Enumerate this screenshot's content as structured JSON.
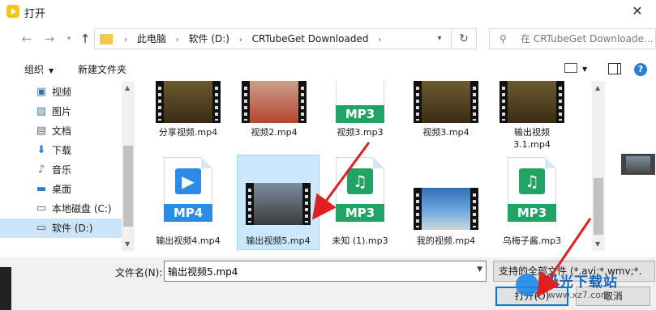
{
  "window": {
    "title": "打开",
    "close": "✕"
  },
  "nav": {
    "crumbs": [
      "此电脑",
      "软件 (D:)",
      "CRTubeGet Downloaded"
    ],
    "search_placeholder": "在 CRTubeGet Downloade..."
  },
  "toolbar": {
    "organize": "组织",
    "new_folder": "新建文件夹"
  },
  "sidebar": {
    "items": [
      {
        "icon": "video-icon",
        "label": "视频"
      },
      {
        "icon": "image-icon",
        "label": "图片"
      },
      {
        "icon": "document-icon",
        "label": "文档"
      },
      {
        "icon": "download-icon",
        "label": "下载"
      },
      {
        "icon": "music-icon",
        "label": "音乐"
      },
      {
        "icon": "desktop-icon",
        "label": "桌面"
      },
      {
        "icon": "drive-icon",
        "label": "本地磁盘 (C:)"
      },
      {
        "icon": "drive-icon",
        "label": "软件 (D:)"
      }
    ],
    "selected_index": 7
  },
  "files": {
    "row1": [
      {
        "name": "分享视频.mp4",
        "kind": "video"
      },
      {
        "name": "视频2.mp4",
        "kind": "video"
      },
      {
        "name": "视频3.mp3",
        "kind": "mp3"
      },
      {
        "name": "视频3.mp4",
        "kind": "video"
      },
      {
        "name": "输出视频3.1.mp4",
        "kind": "video"
      }
    ],
    "row2": [
      {
        "name": "输出视频4.mp4",
        "kind": "mp4doc"
      },
      {
        "name": "输出视频5.mp4",
        "kind": "video",
        "selected": true
      },
      {
        "name": "未知 (1).mp3",
        "kind": "mp3"
      },
      {
        "name": "我的视频.mp4",
        "kind": "video"
      },
      {
        "name": "乌梅子酱.mp3",
        "kind": "mp3"
      }
    ],
    "badge_mp3": "MP3",
    "badge_mp4": "MP4"
  },
  "bottom": {
    "filename_label": "文件名(N):",
    "filename_value": "输出视频5.mp4",
    "filter": "支持的全部文件 (*.avi;*.wmv;*.",
    "open": "打开(O)",
    "cancel": "取消"
  },
  "watermark": {
    "text": "极光下载站",
    "url": "www.xz7.com"
  },
  "colors": {
    "accent": "#0078d7",
    "audio_green": "#21a366",
    "video_blue": "#2b8ce6",
    "selected_bg": "#cce8ff",
    "arrow_red": "#e02020"
  }
}
